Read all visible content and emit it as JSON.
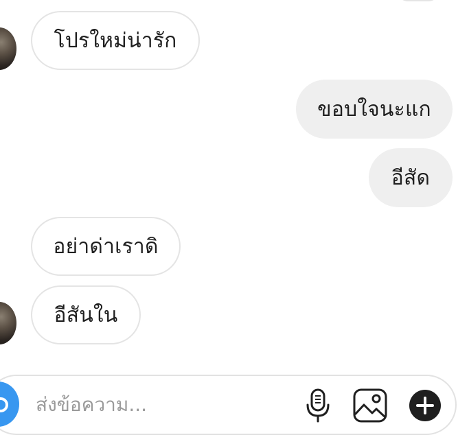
{
  "messages": [
    {
      "direction": "in",
      "text": "โปรใหม่น่ารัก",
      "avatar": true
    },
    {
      "direction": "out",
      "text": "ขอบใจนะแก"
    },
    {
      "direction": "out",
      "text": "อีสัด"
    },
    {
      "direction": "in",
      "text": "อย่าด่าเราดิ"
    },
    {
      "direction": "in",
      "text": "อีสันใน",
      "avatar": true
    }
  ],
  "composer": {
    "placeholder": "ส่งข้อความ...",
    "icons": [
      "camera-icon",
      "microphone-icon",
      "image-icon",
      "plus-icon"
    ]
  },
  "colors": {
    "incoming_bubble_border": "#e4e4e4",
    "outgoing_bubble_bg": "#efefef",
    "camera_button": "#3897f0",
    "placeholder_text": "#9a9a9a"
  }
}
